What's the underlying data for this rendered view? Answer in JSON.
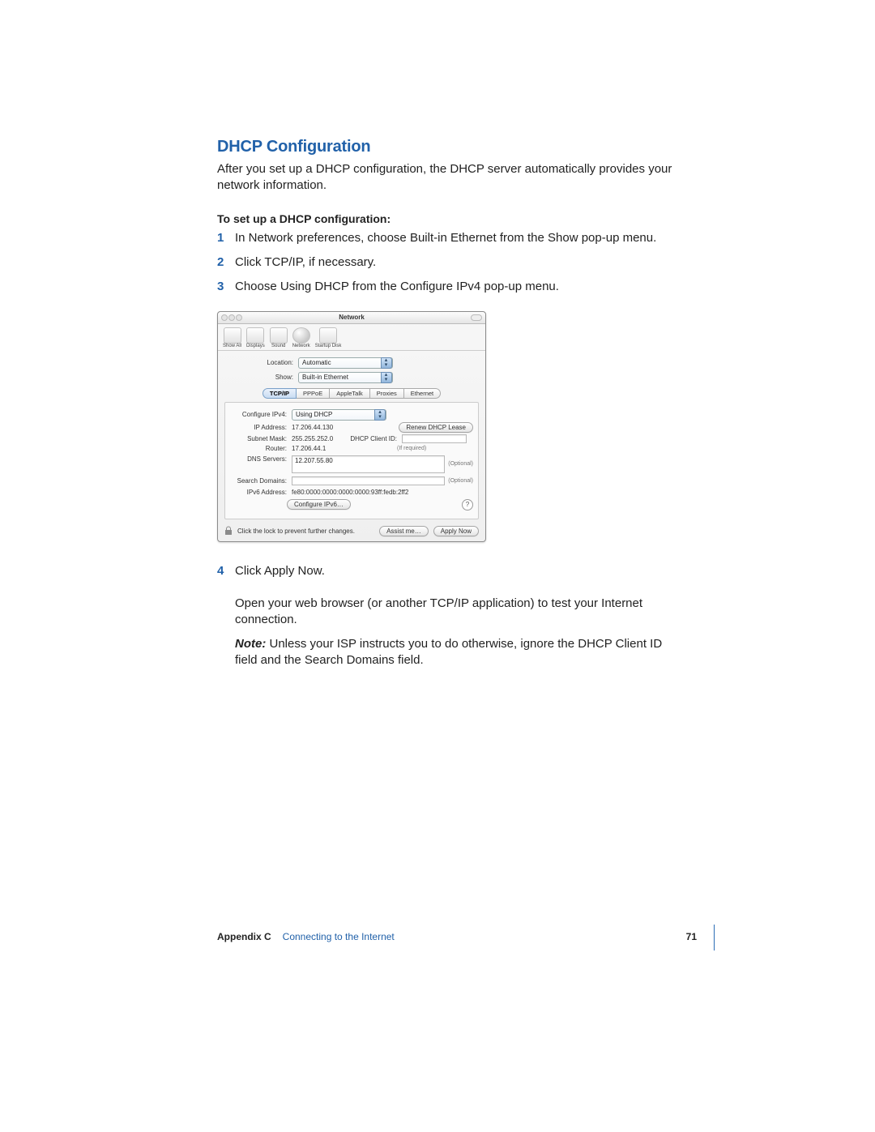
{
  "heading": "DHCP Configuration",
  "intro": "After you set up a DHCP configuration, the DHCP server automatically provides your network information.",
  "subheader": "To set up a DHCP configuration:",
  "steps": [
    "In Network preferences, choose Built-in Ethernet from the Show pop-up menu.",
    "Click TCP/IP, if necessary.",
    "Choose Using DHCP from the Configure IPv4 pop-up menu."
  ],
  "panel": {
    "title": "Network",
    "toolbar": [
      "Show All",
      "Displays",
      "Sound",
      "Network",
      "Startup Disk"
    ],
    "location": {
      "label": "Location:",
      "value": "Automatic"
    },
    "show": {
      "label": "Show:",
      "value": "Built-in Ethernet"
    },
    "tabs": [
      "TCP/IP",
      "PPPoE",
      "AppleTalk",
      "Proxies",
      "Ethernet"
    ],
    "configure": {
      "label": "Configure IPv4:",
      "value": "Using DHCP"
    },
    "ip": {
      "label": "IP Address:",
      "value": "17.206.44.130"
    },
    "renew": "Renew DHCP Lease",
    "subnet": {
      "label": "Subnet Mask:",
      "value": "255.255.252.0"
    },
    "client": {
      "label": "DHCP Client ID:",
      "hint": "(If required)"
    },
    "router": {
      "label": "Router:",
      "value": "17.206.44.1"
    },
    "dns": {
      "label": "DNS Servers:",
      "value": "12.207.55.80",
      "optional": "(Optional)"
    },
    "search": {
      "label": "Search Domains:",
      "optional": "(Optional)"
    },
    "ipv6addr": {
      "label": "IPv6 Address:",
      "value": "fe80:0000:0000:0000:0000:93ff:fedb:2ff2"
    },
    "configv6": "Configure IPv6…",
    "lockhint": "Click the lock to prevent further changes.",
    "assist": "Assist me…",
    "apply": "Apply Now"
  },
  "step4": "Click Apply Now.",
  "open_browser": "Open your web browser (or another TCP/IP application) to test your Internet connection.",
  "note_label": "Note:",
  "note_body": "  Unless your ISP instructs you to do otherwise, ignore the DHCP Client ID field and the Search Domains field.",
  "footer": {
    "appendix": "Appendix C",
    "title": "Connecting to the Internet",
    "page": "71"
  }
}
